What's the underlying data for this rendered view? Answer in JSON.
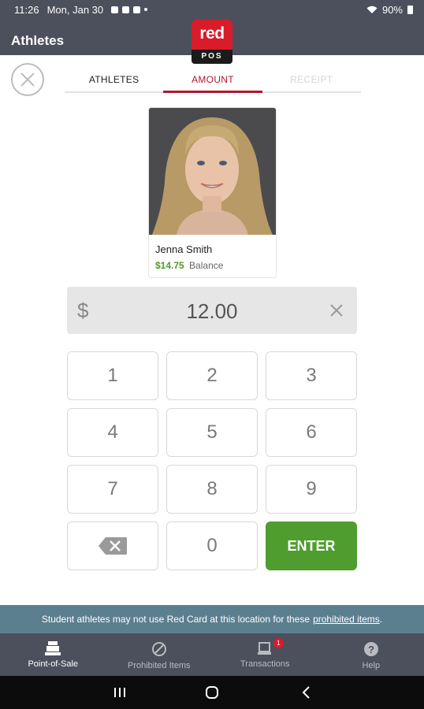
{
  "status_bar": {
    "time": "11:26",
    "date": "Mon, Jan 30",
    "battery": "90%"
  },
  "header": {
    "title": "Athletes"
  },
  "logo": {
    "top": "red",
    "bottom": "POS"
  },
  "tabs": [
    {
      "label": "ATHLETES",
      "state": "normal"
    },
    {
      "label": "AMOUNT",
      "state": "active"
    },
    {
      "label": "RECEIPT",
      "state": "disabled"
    }
  ],
  "athlete": {
    "name": "Jenna Smith",
    "balance": "$14.75",
    "balance_label": "Balance"
  },
  "amount": {
    "currency": "$",
    "value": "12.00"
  },
  "keypad": {
    "keys": [
      "1",
      "2",
      "3",
      "4",
      "5",
      "6",
      "7",
      "8",
      "9",
      "0"
    ],
    "enter_label": "ENTER"
  },
  "notice": {
    "text": "Student athletes may not use Red Card at this location for these",
    "link": "prohibited items",
    "end": "."
  },
  "bottom_nav": [
    {
      "label": "Point-of-Sale",
      "icon": "register-icon",
      "active": true
    },
    {
      "label": "Prohibited Items",
      "icon": "prohibited-icon",
      "active": false
    },
    {
      "label": "Transactions",
      "icon": "receipt-icon",
      "active": false,
      "badge": "1"
    },
    {
      "label": "Help",
      "icon": "help-icon",
      "active": false
    }
  ],
  "colors": {
    "header": "#4c4f5c",
    "brand_red": "#d91c2a",
    "tab_active": "#b3162b",
    "enter": "#4f9d2f",
    "notice": "#5c7f90"
  }
}
